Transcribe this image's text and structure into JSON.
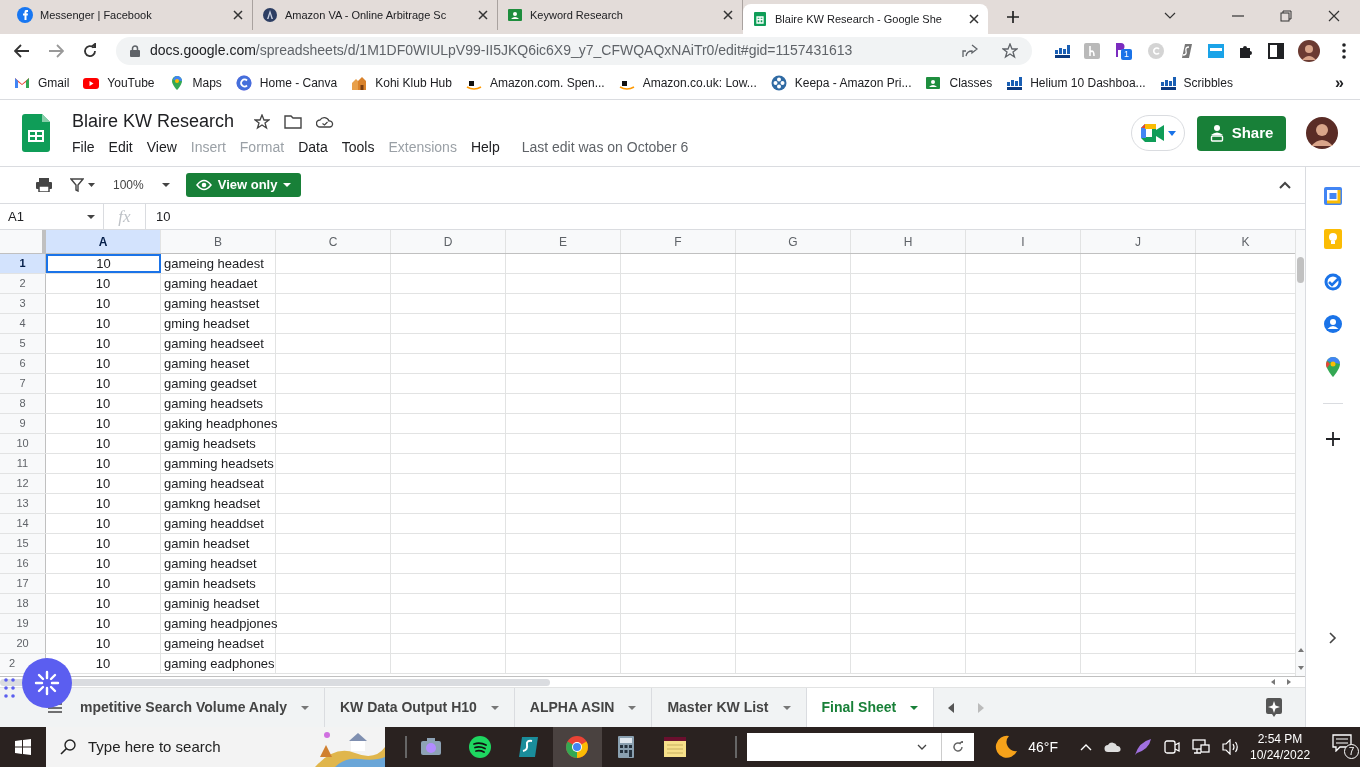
{
  "browser_tabs": [
    {
      "title": "Messenger | Facebook",
      "selected": false
    },
    {
      "title": "Amazon VA - Online Arbitrage Sc",
      "selected": false
    },
    {
      "title": "Keyword Research",
      "selected": false
    },
    {
      "title": "Blaire KW Research - Google She",
      "selected": true
    }
  ],
  "address": {
    "host": "docs.google.com",
    "path": "/spreadsheets/d/1M1DF0WIULpV99-II5JKQ6ic6X9_y7_CFWQAQxNAiTr0/edit#gid=1157431613"
  },
  "extension_badge": "1",
  "bookmarks": [
    "Gmail",
    "YouTube",
    "Maps",
    "Home - Canva",
    "Kohi Klub Hub",
    "Amazon.com. Spen...",
    "Amazon.co.uk: Low...",
    "Keepa - Amazon Pri...",
    "Classes",
    "Helium 10 Dashboa...",
    "Scribbles"
  ],
  "bookmarks_more": "»",
  "doc": {
    "title": "Blaire KW Research",
    "menu": [
      {
        "label": "File",
        "disabled": false
      },
      {
        "label": "Edit",
        "disabled": false
      },
      {
        "label": "View",
        "disabled": false
      },
      {
        "label": "Insert",
        "disabled": true
      },
      {
        "label": "Format",
        "disabled": true
      },
      {
        "label": "Data",
        "disabled": false
      },
      {
        "label": "Tools",
        "disabled": false
      },
      {
        "label": "Extensions",
        "disabled": true
      },
      {
        "label": "Help",
        "disabled": false
      }
    ],
    "last_edit": "Last edit was on October 6",
    "share": "Share"
  },
  "toolbar": {
    "zoom": "100%",
    "mode": "View only"
  },
  "formula_bar": {
    "cell": "A1",
    "fx": "fx",
    "value": "10"
  },
  "columns": [
    {
      "label": "A",
      "selected": true
    },
    {
      "label": "B",
      "selected": false
    },
    {
      "label": "C",
      "selected": false
    },
    {
      "label": "D",
      "selected": false
    },
    {
      "label": "E",
      "selected": false
    },
    {
      "label": "F",
      "selected": false
    },
    {
      "label": "G",
      "selected": false
    },
    {
      "label": "H",
      "selected": false
    },
    {
      "label": "I",
      "selected": false
    },
    {
      "label": "J",
      "selected": false
    },
    {
      "label": "K",
      "selected": false
    }
  ],
  "rows": [
    {
      "number": "1",
      "selected": true,
      "cells": [
        "10",
        "gameing headest"
      ]
    },
    {
      "number": "2",
      "selected": false,
      "cells": [
        "10",
        "gaming headaet"
      ]
    },
    {
      "number": "3",
      "selected": false,
      "cells": [
        "10",
        "gaming heastset"
      ]
    },
    {
      "number": "4",
      "selected": false,
      "cells": [
        "10",
        "gming headset"
      ]
    },
    {
      "number": "5",
      "selected": false,
      "cells": [
        "10",
        "gaming headseet"
      ]
    },
    {
      "number": "6",
      "selected": false,
      "cells": [
        "10",
        "gaming heaset"
      ]
    },
    {
      "number": "7",
      "selected": false,
      "cells": [
        "10",
        "gaming geadset"
      ]
    },
    {
      "number": "8",
      "selected": false,
      "cells": [
        "10",
        "gaming headsets"
      ]
    },
    {
      "number": "9",
      "selected": false,
      "cells": [
        "10",
        "gaking headphones"
      ]
    },
    {
      "number": "10",
      "selected": false,
      "cells": [
        "10",
        "gamig headsets"
      ]
    },
    {
      "number": "11",
      "selected": false,
      "cells": [
        "10",
        "gamming headsets"
      ]
    },
    {
      "number": "12",
      "selected": false,
      "cells": [
        "10",
        "gaming headseat"
      ]
    },
    {
      "number": "13",
      "selected": false,
      "cells": [
        "10",
        "gamkng headset"
      ]
    },
    {
      "number": "14",
      "selected": false,
      "cells": [
        "10",
        "gaming headdset"
      ]
    },
    {
      "number": "15",
      "selected": false,
      "cells": [
        "10",
        "gamin headset"
      ]
    },
    {
      "number": "16",
      "selected": false,
      "cells": [
        "10",
        "gaming headset"
      ]
    },
    {
      "number": "17",
      "selected": false,
      "cells": [
        "10",
        "gamin headsets"
      ]
    },
    {
      "number": "18",
      "selected": false,
      "cells": [
        "10",
        "gaminig headset"
      ]
    },
    {
      "number": "19",
      "selected": false,
      "cells": [
        "10",
        "gaming headpjones"
      ]
    },
    {
      "number": "20",
      "selected": false,
      "cells": [
        "10",
        "gameing headset"
      ]
    },
    {
      "number": "2",
      "selected": false,
      "cells": [
        "10",
        "gaming eadphones"
      ]
    }
  ],
  "sheet_tabs": [
    {
      "label": "mpetitive Search Volume Analy",
      "selected": false
    },
    {
      "label": "KW Data Output H10",
      "selected": false
    },
    {
      "label": "ALPHA ASIN",
      "selected": false
    },
    {
      "label": "Master KW List",
      "selected": false
    },
    {
      "label": "Final Sheet",
      "selected": true
    }
  ],
  "taskbar": {
    "search_placeholder": "Type here to search",
    "weather": "46°F",
    "time": "2:54 PM",
    "date": "10/24/2022",
    "notifications": "7"
  }
}
